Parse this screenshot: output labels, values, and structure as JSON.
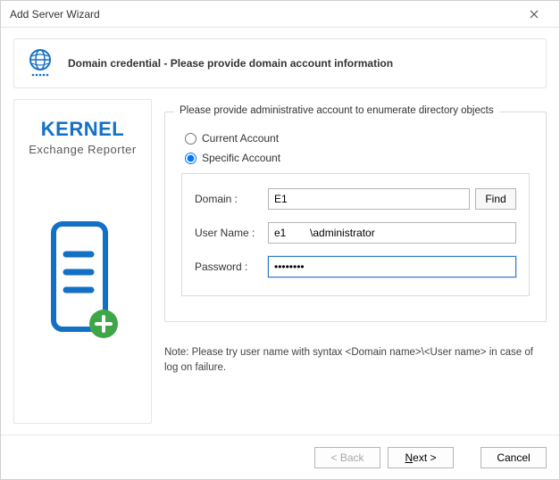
{
  "window": {
    "title": "Add Server Wizard"
  },
  "banner": {
    "heading": "Domain credential  - Please provide domain account information"
  },
  "brand": {
    "name": "KERNEL",
    "sub": "Exchange Reporter"
  },
  "form": {
    "legend": "Please provide administrative account to enumerate directory objects",
    "radio_current": "Current Account",
    "radio_specific": "Specific Account",
    "selected": "specific",
    "domain_label": "Domain :",
    "domain_value": "E1",
    "find_label": "Find",
    "username_label": "User Name :",
    "username_value": "e1        \\administrator",
    "password_label": "Password :",
    "password_value": "••••••••",
    "note": "Note: Please try user name with syntax <Domain name>\\<User name> in case of log on failure."
  },
  "footer": {
    "back": "< Back",
    "next_prefix": "N",
    "next_suffix": "ext >",
    "cancel": "Cancel"
  }
}
